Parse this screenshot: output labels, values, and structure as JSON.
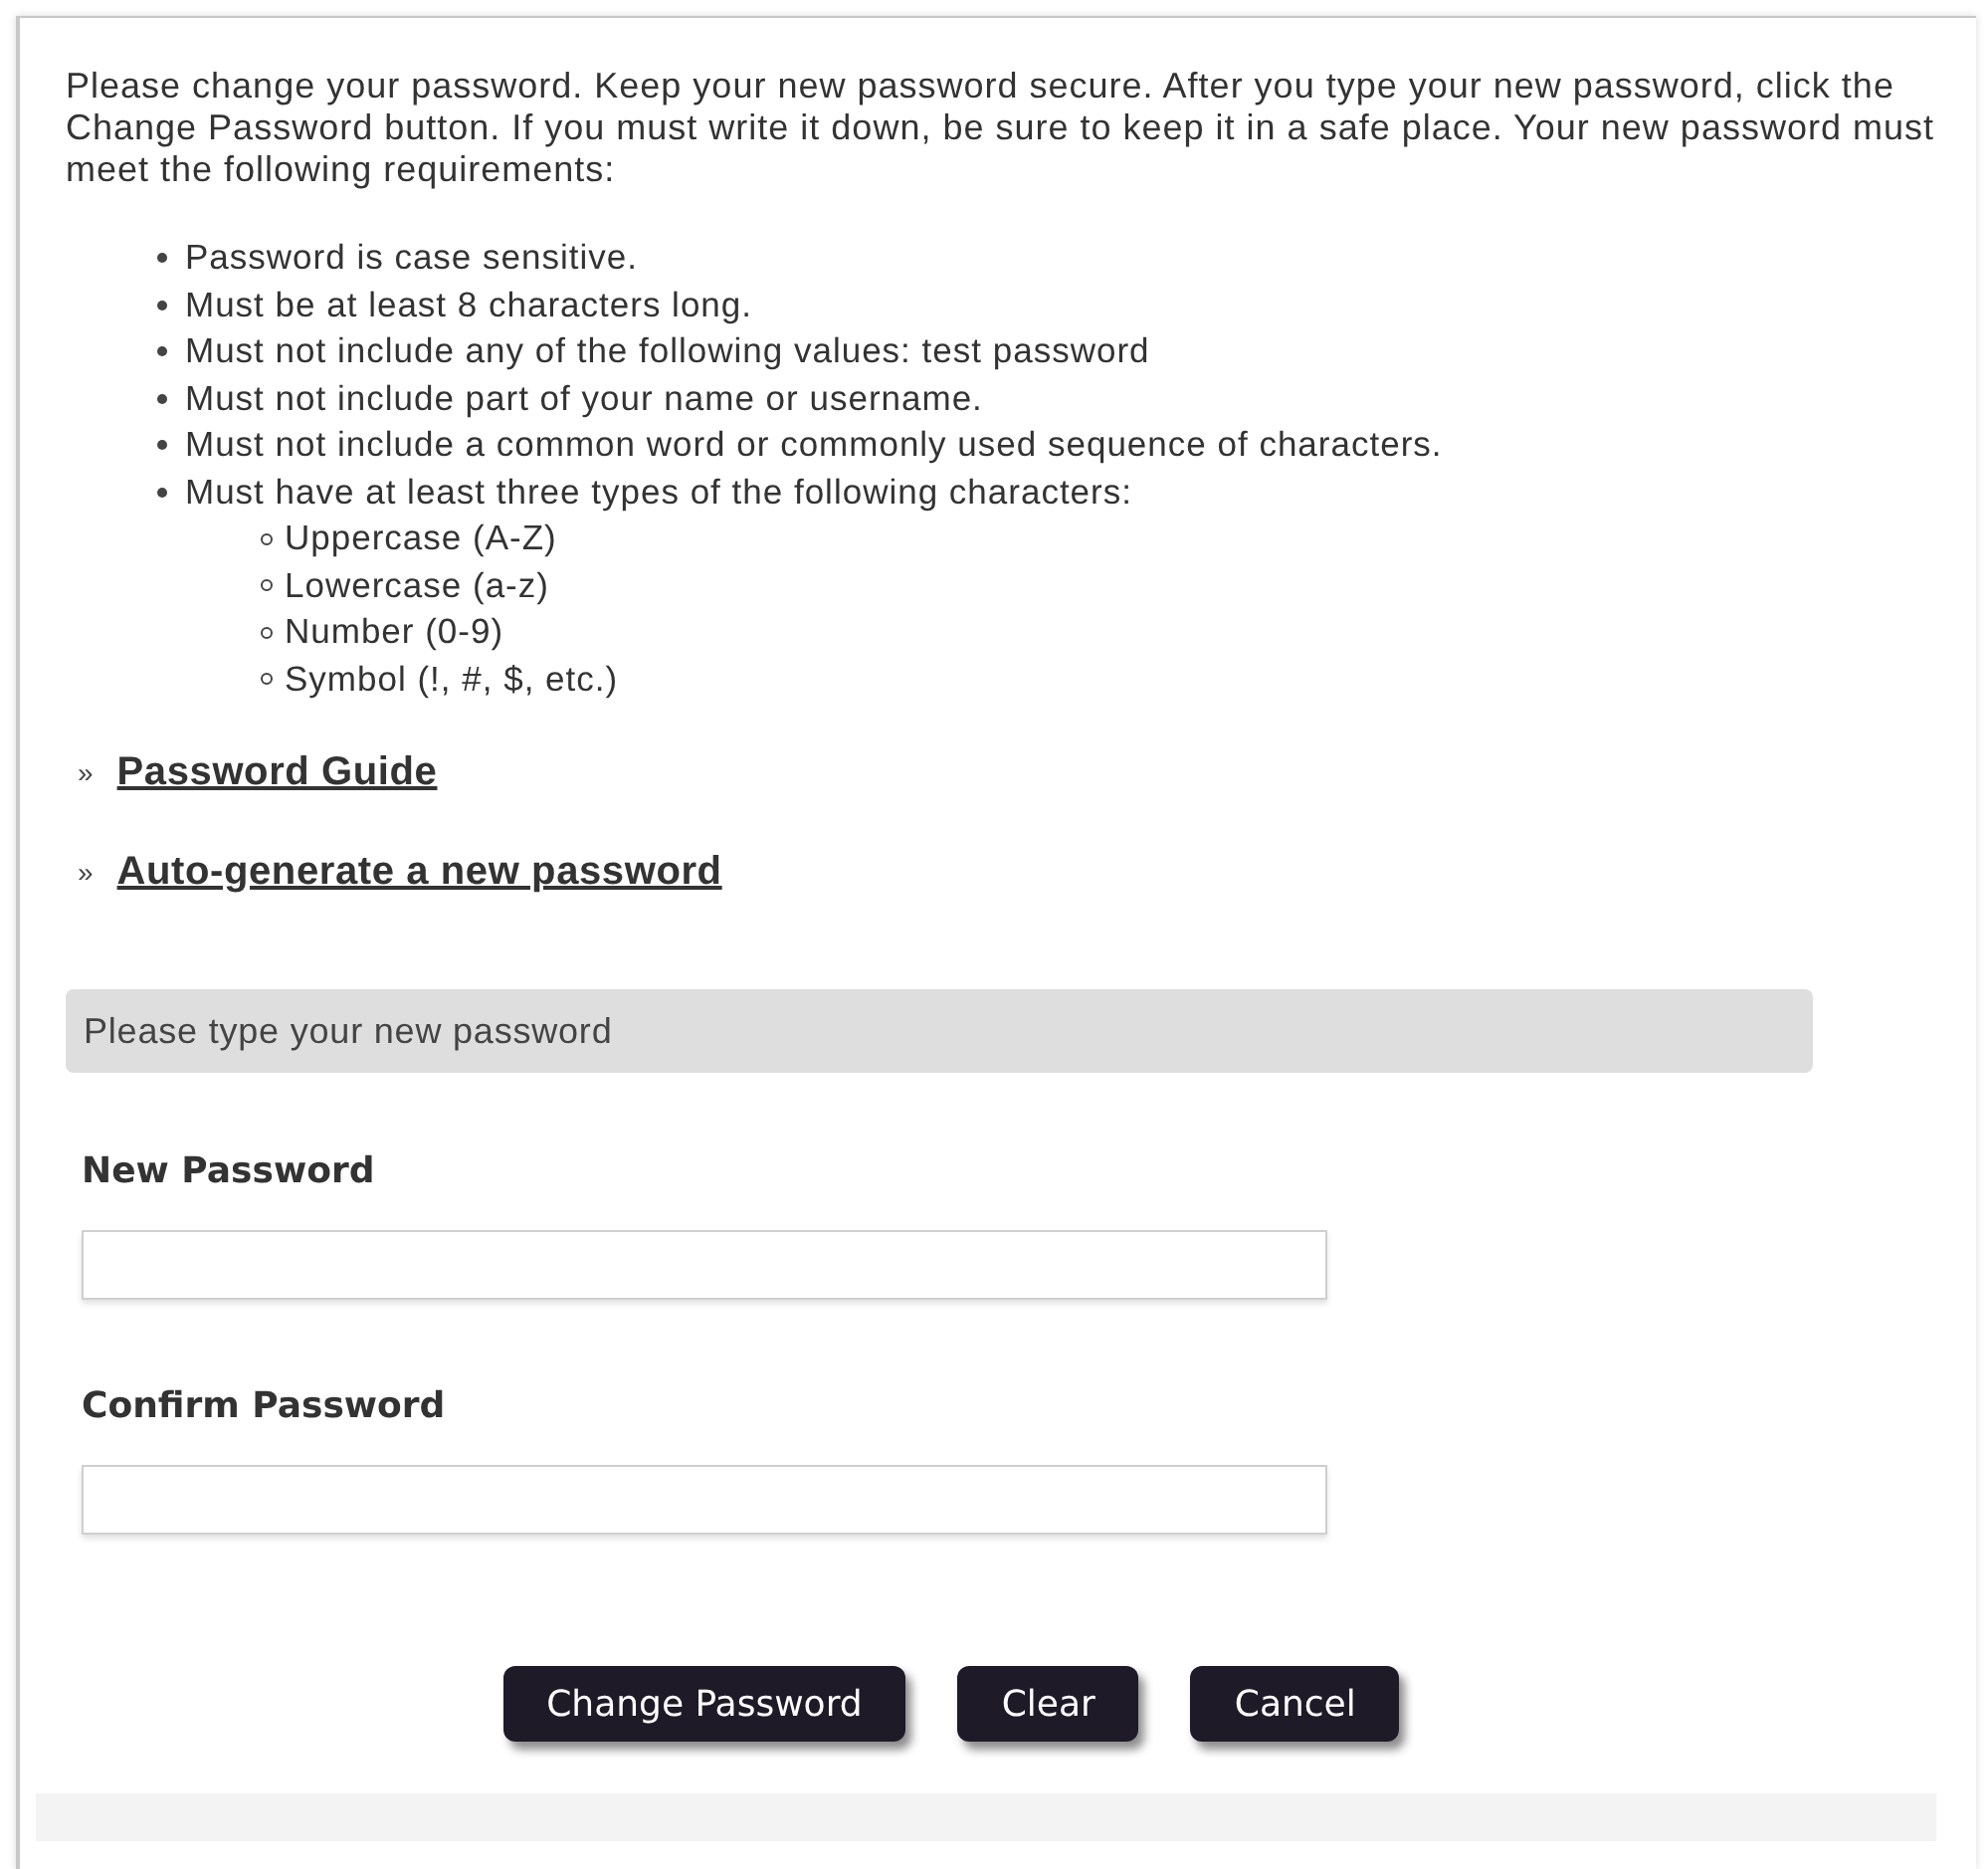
{
  "intro": "Please change your password. Keep your new password secure. After you type your new password, click the Change Password button. If you must write it down, be sure to keep it in a safe place. Your new password must meet the following requirements:",
  "requirements": [
    {
      "text": "Password is case sensitive."
    },
    {
      "text": "Must be at least 8 characters long."
    },
    {
      "text": "Must not include any of the following values: test password"
    },
    {
      "text": "Must not include part of your name or username."
    },
    {
      "text": "Must not include a common word or commonly used sequence of characters."
    },
    {
      "text": "Must have at least three types of the following characters:",
      "children": [
        {
          "text": "Uppercase (A-Z)"
        },
        {
          "text": "Lowercase (a-z)"
        },
        {
          "text": "Number (0-9)"
        },
        {
          "text": "Symbol (!, #, $, etc.)"
        }
      ]
    }
  ],
  "links": [
    {
      "marker": "»",
      "label": "Password Guide"
    },
    {
      "marker": "»",
      "label": "Auto-generate a new password"
    }
  ],
  "section_header": "Please type your new password",
  "fields": [
    {
      "label": "New Password"
    },
    {
      "label": "Confirm Password"
    }
  ],
  "buttons": [
    "Change Password",
    "Clear",
    "Cancel"
  ]
}
